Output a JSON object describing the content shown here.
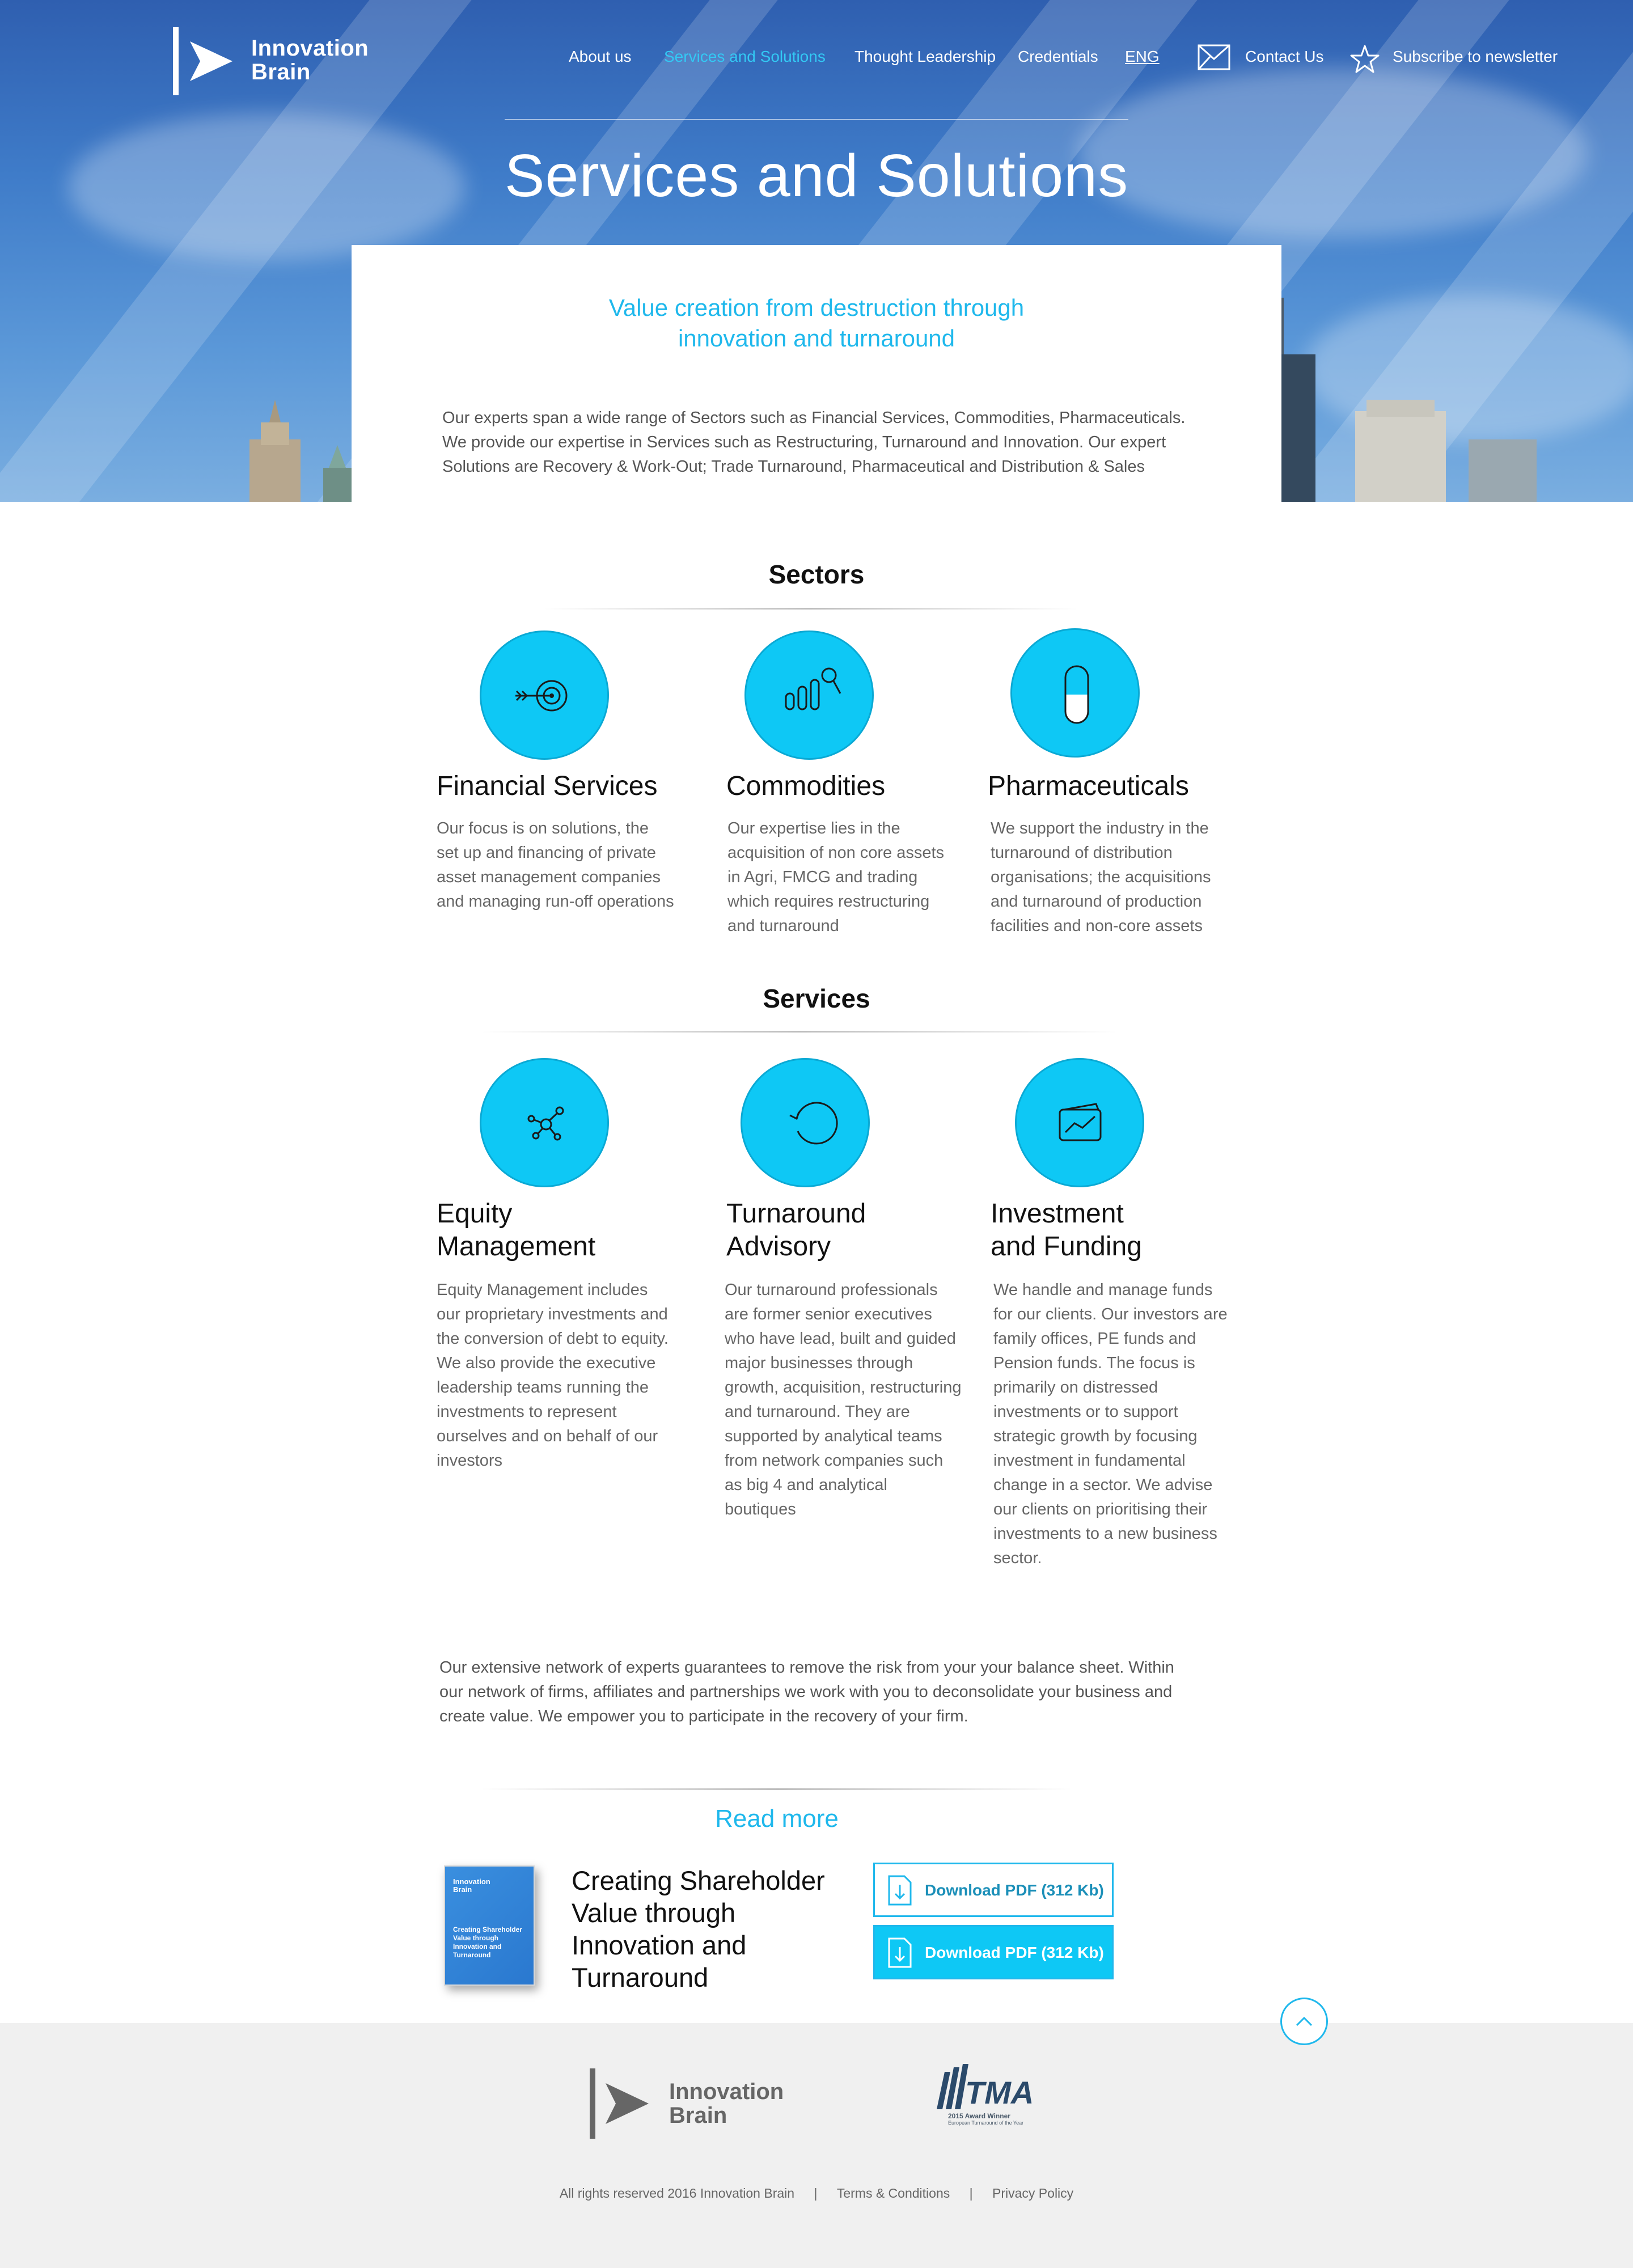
{
  "brand": {
    "name_line1": "Innovation",
    "name_line2": "Brain"
  },
  "nav": {
    "items": [
      "About us",
      "Services and Solutions",
      "Thought Leadership",
      "Credentials",
      "ENG"
    ],
    "active": "Services and Solutions",
    "contact_label": "Contact Us",
    "subscribe_label": "Subscribe to newsletter",
    "contact_icon": "envelope-icon",
    "subscribe_icon": "star-icon"
  },
  "hero": {
    "title": "Services and Solutions"
  },
  "intro": {
    "tagline_line1": "Value creation from destruction through",
    "tagline_line2": "innovation and turnaround",
    "text": "Our experts span a wide range of Sectors such as Financial Services, Commodities, Pharmaceuticals. We provide our expertise in Services such as Restructuring, Turnaround and Innovation. Our expert Solutions are Recovery & Work-Out; Trade Turnaround, Pharmaceutical and Distribution & Sales"
  },
  "sectors": {
    "heading": "Sectors",
    "items": [
      {
        "icon": "target-arrow-icon",
        "title": "Financial Services",
        "text": "Our focus is on solutions, the set up and financing of private asset management companies and managing run-off operations"
      },
      {
        "icon": "bar-chart-search-icon",
        "title": "Commodities",
        "text": "Our expertise lies in the acquisition of non core assets in Agri, FMCG and trading which requires restructuring and turnaround"
      },
      {
        "icon": "pill-capsule-icon",
        "title": "Pharmaceuticals",
        "text": "We support the industry in the turnaround of distribution organisations; the acquisitions and turnaround of production facilities and non-core assets"
      }
    ]
  },
  "services": {
    "heading": "Services",
    "items": [
      {
        "icon": "network-nodes-icon",
        "title_line1": "Equity",
        "title_line2": "Management",
        "text": "Equity Management includes our proprietary investments and the conversion of debt to equity. We also provide the executive leadership teams running the investments to represent ourselves and on behalf of our investors"
      },
      {
        "icon": "refresh-cycle-icon",
        "title_line1": "Turnaround",
        "title_line2": "Advisory",
        "text": "Our turnaround professionals are former senior executives who have lead, built and guided major businesses through growth, acquisition, restructuring and turnaround. They are supported by analytical teams from network companies such as big 4 and analytical boutiques"
      },
      {
        "icon": "wallet-chart-icon",
        "title_line1": "Investment",
        "title_line2": "and Funding",
        "text": "We handle and manage funds for our clients. Our investors are family offices, PE funds and Pension funds. The focus is primarily on distressed investments or to support strategic growth by focusing investment in fundamental change in a sector. We advise our clients on prioritising their investments to a new business sector."
      }
    ]
  },
  "closing": {
    "text": "Our extensive network of experts guarantees to remove the risk from your your balance sheet. Within our network of firms, affiliates and partnerships we work with you to deconsolidate your business and create value. We empower you to participate in the recovery of your firm."
  },
  "read_more": {
    "label": "Read more",
    "book_cover_brand_line1": "Innovation",
    "book_cover_brand_line2": "Brain",
    "book_cover_title": "Creating Shareholder Value through Innovation and Turnaround",
    "book_title_line1": "Creating Shareholder",
    "book_title_line2": "Value through",
    "book_title_line3": "Innovation and",
    "book_title_line4": "Turnaround",
    "download_label": "Download PDF (312 Kb)",
    "download_label_2": "Download PDF (312 Kb)"
  },
  "footer": {
    "brand_line1": "Innovation",
    "brand_line2": "Brain",
    "award_name": "TMA",
    "award_line1": "2015 Award Winner",
    "award_line2": "European Turnaround of the Year",
    "copyright": "All rights reserved 2016 Innovation Brain",
    "separator": "|",
    "terms": "Terms & Conditions",
    "privacy": "Privacy Policy"
  },
  "colors": {
    "accent": "#0ec8f5",
    "accent_text": "#1fb8ec",
    "footer_bg": "#f0f0f0"
  }
}
